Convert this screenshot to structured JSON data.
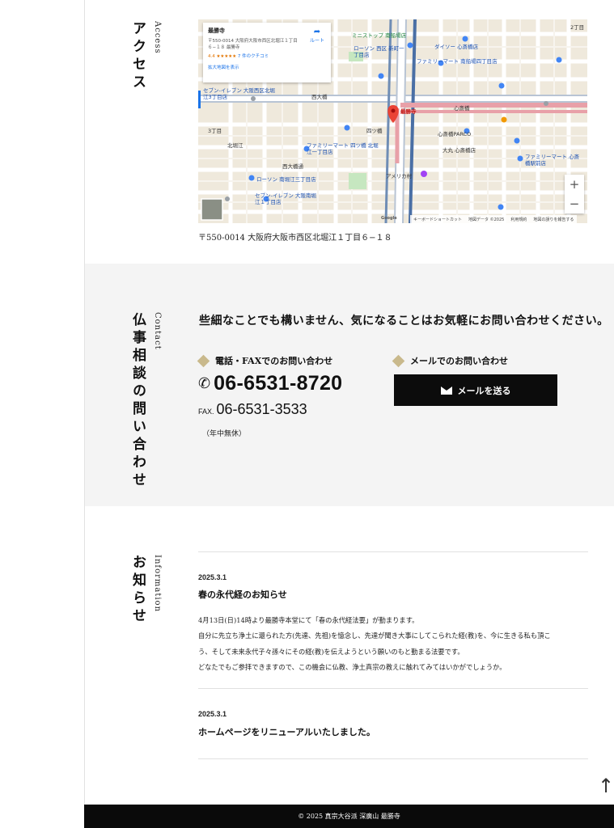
{
  "access": {
    "heading_en": "Access",
    "heading_ja": "アクセス",
    "map_card": {
      "name": "最勝寺",
      "address": "〒550-0014 大阪府大阪市西区北堀江１丁目６−１８ 最勝寺",
      "rating": "4.4",
      "stars": "★★★★★",
      "reviews": "7 件のクチコミ",
      "large_map_link": "拡大地図を表示",
      "directions_label": "ルート"
    },
    "map_labels": {
      "pin": "最勝寺",
      "yotsubashi": "四ツ橋",
      "nishiohashi": "西大橋",
      "shinsaibashi": "心斎橋",
      "famima_yotsubashi": "ファミリーマート 四ツ橋 北堀江一丁目店",
      "lawson_minamihorie": "ローソン 南堀江三丁目店",
      "seven_minamihorie": "セブン-イレブン 大阪南堀江１丁目店",
      "seven_nishiku": "セブン-イレブン 大阪西区北堀江3丁目店",
      "amerikamura": "アメリカ村",
      "daimaru": "大丸 心斎橋店",
      "parco": "心斎橋PARCO",
      "mini_stop": "ミニストップ 南船場店",
      "lawson_shinmachi": "ローソン 西区 新町一丁目店",
      "famima_minamisenba": "ファミリーマート 南船場四丁目店",
      "daiso": "ダイソー 心斎橋店",
      "famima_shinsaibashi": "ファミリーマート 心斎橋駅前店",
      "kitahorie": "北堀江",
      "nishiohashi_dori": "西大橋通",
      "sanchome": "3丁目",
      "chome2": "2丁目"
    },
    "map_footer": {
      "google": "Google",
      "shortcuts": "キーボードショートカット",
      "map_data": "地図データ ©2025",
      "terms": "利用規約",
      "report": "地図の誤りを報告する"
    },
    "zoom_in": "+",
    "zoom_out": "−",
    "address": "〒550-0014 大阪府大阪市西区北堀江１丁目６−１８"
  },
  "contact": {
    "heading_en": "Contact",
    "heading_ja": "仏事相談の問い合わせ",
    "lead": "些細なことでも構いません、気になることはお気軽にお問い合わせください。",
    "phone_heading": "電話・FAXでのお問い合わせ",
    "phone_icon": "phone-icon",
    "phone": "06-6531-8720",
    "fax_label": "FAX.",
    "fax": "06-6531-3533",
    "note": "（年中無休）",
    "mail_heading": "メールでのお問い合わせ",
    "mail_button": "メールを送る"
  },
  "information": {
    "heading_en": "Information",
    "heading_ja": "お知らせ",
    "items": [
      {
        "date": "2025.3.1",
        "title": "春の永代経のお知らせ",
        "body": [
          "4月13日(日)14時より最勝寺本堂にて「春の永代経法要」が勤まります。",
          "自分に先立ち浄土に還られた方(先達、先祖)を憶念し、先達が聞き大事にしてこられた経(教)を、今に生きる私も頂こ",
          "う、そして未来永代子々孫々にその経(教)を伝えようという願いのもと勤まる法要です。",
          "どなたでもご参拝できますので、この機会に仏教、浄土真宗の教えに触れてみてはいかがでしょうか。"
        ]
      },
      {
        "date": "2025.3.1",
        "title": "ホームページをリニューアルいたしました。"
      }
    ]
  },
  "page_top": "↑",
  "footer": "© 2025 真宗大谷派 深廣山 最勝寺",
  "colors": {
    "accent_diamond": "#c9b98c",
    "band": "#f4f4f4",
    "footer_bg": "#0a0a0a",
    "button_bg": "#0c0c0c"
  }
}
